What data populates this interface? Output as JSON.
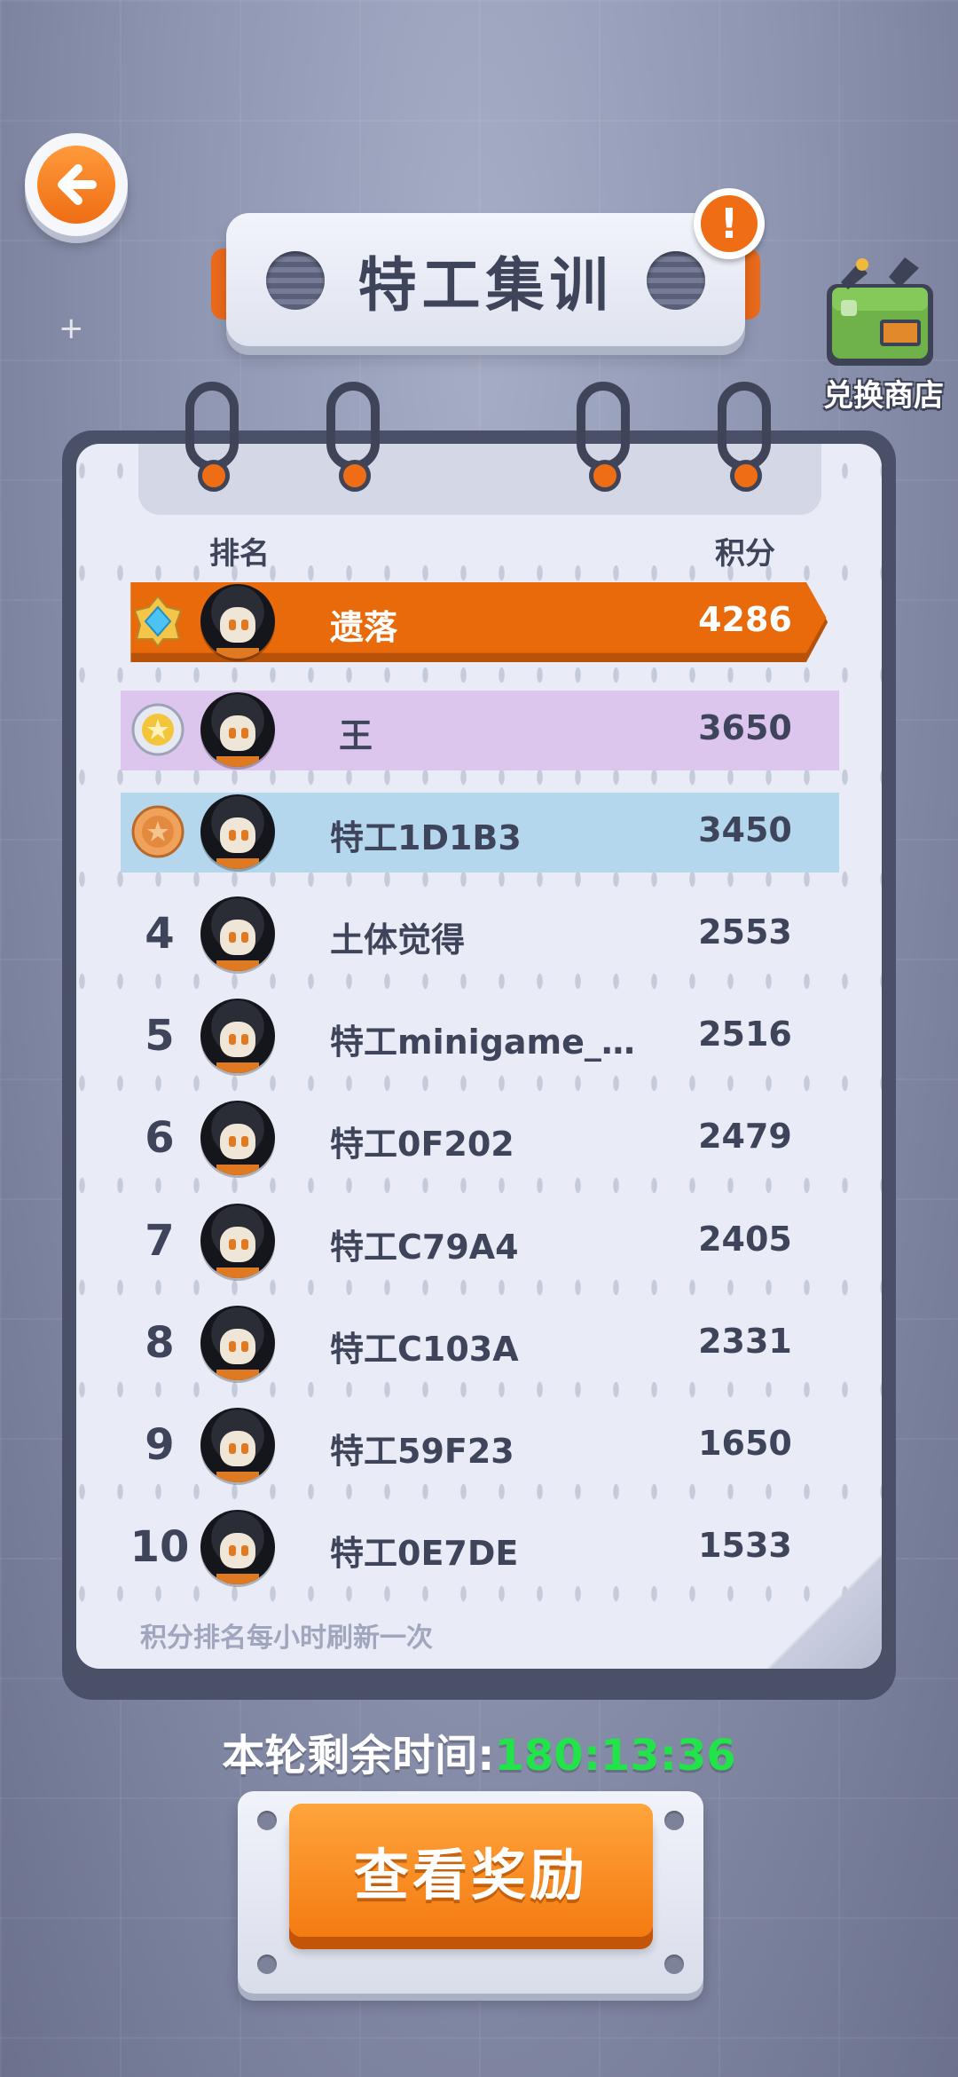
{
  "header": {
    "title": "特工集训",
    "info_glyph": "!",
    "shop_label": "兑换商店",
    "back_icon": "back-arrow-icon"
  },
  "table": {
    "col_rank": "排名",
    "col_score": "积分",
    "rows": [
      {
        "rank": "1",
        "medal": "diamond",
        "name": "遗落",
        "score": "4286"
      },
      {
        "rank": "2",
        "medal": "gold",
        "name": "王",
        "score": "3650"
      },
      {
        "rank": "3",
        "medal": "bronze",
        "name": "特工1D1B3",
        "score": "3450"
      },
      {
        "rank": "4",
        "name": "土体觉得",
        "score": "2553"
      },
      {
        "rank": "5",
        "name": "特工minigame_…",
        "score": "2516"
      },
      {
        "rank": "6",
        "name": "特工0F202",
        "score": "2479"
      },
      {
        "rank": "7",
        "name": "特工C79A4",
        "score": "2405"
      },
      {
        "rank": "8",
        "name": "特工C103A",
        "score": "2331"
      },
      {
        "rank": "9",
        "name": "特工59F23",
        "score": "1650"
      },
      {
        "rank": "10",
        "name": "特工0E7DE",
        "score": "1533"
      }
    ],
    "footnote": "积分排名每小时刷新一次"
  },
  "timer": {
    "label": "本轮剩余时间:",
    "value": "180:13:36"
  },
  "reward_button": "查看奖励",
  "colors": {
    "accent_orange": "#ef6d14",
    "gold_row": "#dcc6ee",
    "bronze_row": "#b5d7ee",
    "timer_green": "#22e34a"
  }
}
